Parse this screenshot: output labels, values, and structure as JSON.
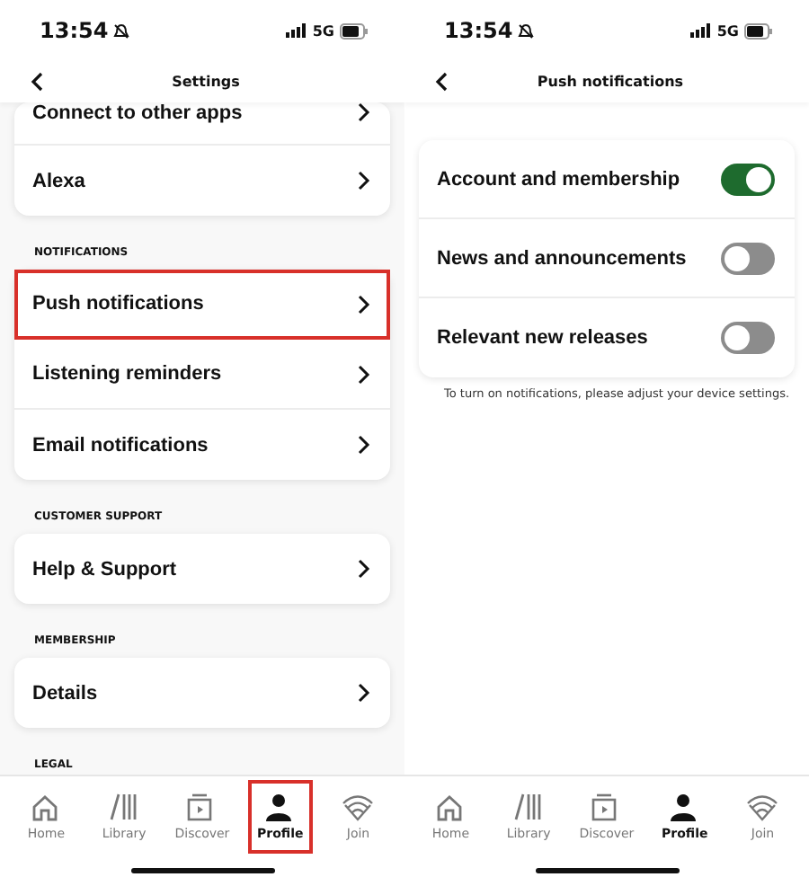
{
  "screens": [
    {
      "status_bar": {
        "time": "13:54",
        "network": "5G"
      },
      "header": {
        "title": "Settings"
      },
      "sections": [
        {
          "rows": [
            {
              "label": "Connect to other apps",
              "kind": "link",
              "highlighted": false
            },
            {
              "label": "Alexa",
              "kind": "link",
              "highlighted": false
            }
          ]
        },
        {
          "heading": "NOTIFICATIONS",
          "rows": [
            {
              "label": "Push notifications",
              "kind": "link",
              "highlighted": true
            },
            {
              "label": "Listening reminders",
              "kind": "link",
              "highlighted": false
            },
            {
              "label": "Email notifications",
              "kind": "link",
              "highlighted": false
            }
          ]
        },
        {
          "heading": "CUSTOMER SUPPORT",
          "rows": [
            {
              "label": "Help & Support",
              "kind": "link",
              "highlighted": false
            }
          ]
        },
        {
          "heading": "MEMBERSHIP",
          "rows": [
            {
              "label": "Details",
              "kind": "link",
              "highlighted": false
            }
          ]
        },
        {
          "heading": "LEGAL"
        }
      ],
      "tab_bar": [
        {
          "label": "Home",
          "selected": false,
          "highlighted": false
        },
        {
          "label": "Library",
          "selected": false,
          "highlighted": false
        },
        {
          "label": "Discover",
          "selected": false,
          "highlighted": false
        },
        {
          "label": "Profile",
          "selected": true,
          "highlighted": true
        },
        {
          "label": "Join",
          "selected": false,
          "highlighted": false
        }
      ]
    },
    {
      "status_bar": {
        "time": "13:54",
        "network": "5G"
      },
      "header": {
        "title": "Push notifications"
      },
      "sections": [
        {
          "rows": [
            {
              "label": "Account and membership",
              "kind": "toggle",
              "on": true
            },
            {
              "label": "News and announcements",
              "kind": "toggle",
              "on": false
            },
            {
              "label": "Relevant new releases",
              "kind": "toggle",
              "on": false
            }
          ],
          "note": "To turn on notifications, please adjust your device settings."
        }
      ],
      "tab_bar": [
        {
          "label": "Home",
          "selected": false
        },
        {
          "label": "Library",
          "selected": false
        },
        {
          "label": "Discover",
          "selected": false
        },
        {
          "label": "Profile",
          "selected": true
        },
        {
          "label": "Join",
          "selected": false
        }
      ]
    }
  ]
}
